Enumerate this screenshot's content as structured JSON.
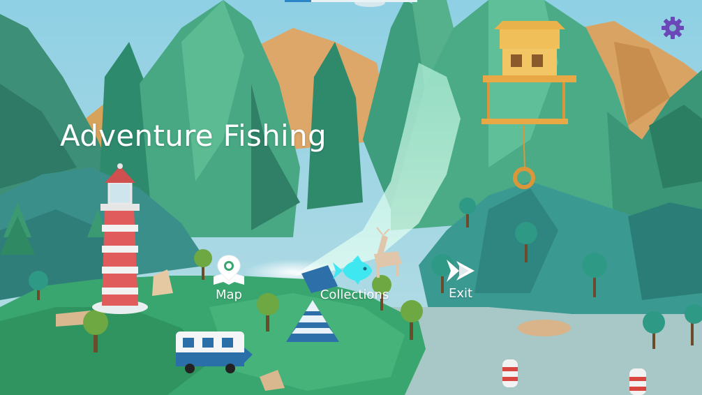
{
  "game": {
    "title": "Adventure Fishing"
  },
  "menu": {
    "map": {
      "label": "Map",
      "icon": "map-pin-icon"
    },
    "collections": {
      "label": "Collections",
      "icon": "fish-icon",
      "active": true
    },
    "exit": {
      "label": "Exit",
      "icon": "exit-fish-icon"
    }
  },
  "settings": {
    "icon": "gear-icon"
  },
  "loading": {
    "progress": 0.2
  },
  "colors": {
    "active_highlight": "#3fe7f0",
    "gear": "#6b47b8",
    "lighthouse_red": "#d85a5a",
    "water": "#a9c9c9",
    "grass": "#3aa36e"
  }
}
